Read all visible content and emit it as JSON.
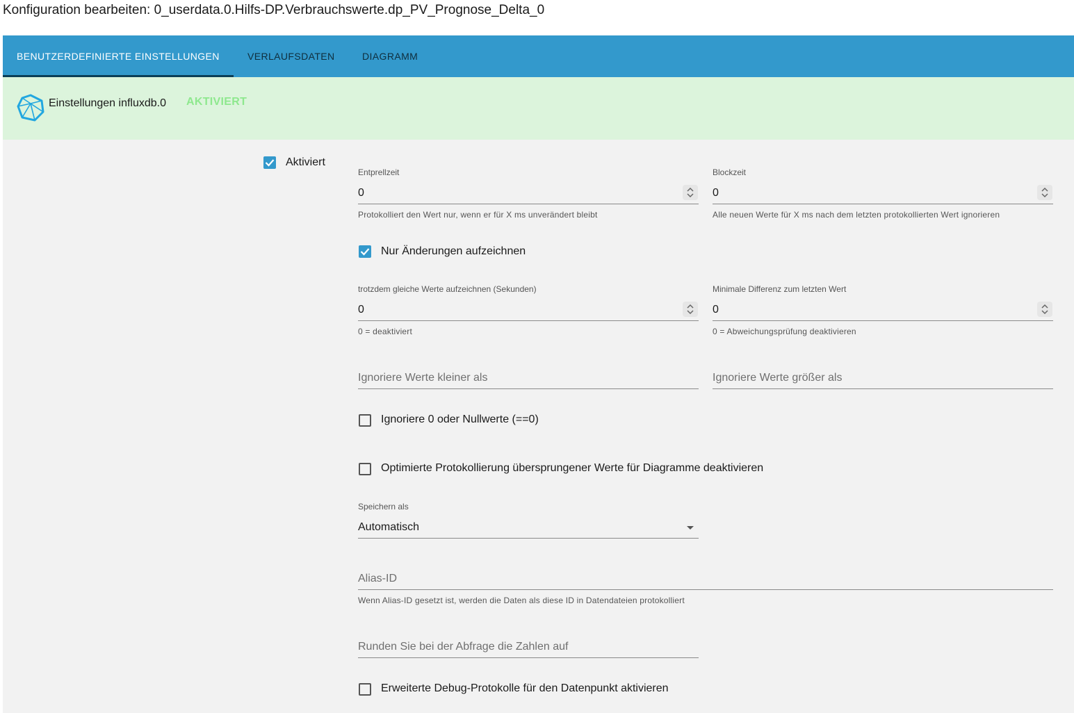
{
  "dialog": {
    "title": "Konfiguration bearbeiten: 0_userdata.0.Hilfs-DP.Verbrauchswerte.dp_PV_Prognose_Delta_0"
  },
  "tabs": [
    {
      "label": "BENUTZERDEFINIERTE EINSTELLUNGEN",
      "active": true
    },
    {
      "label": "VERLAUFSDATEN",
      "active": false
    },
    {
      "label": "DIAGRAMM",
      "active": false
    }
  ],
  "instance": {
    "icon": "influxdb-icon",
    "name": "Einstellungen influxdb.0",
    "status": "AKTIVIERT",
    "status_color": "#8ee88e"
  },
  "settings": {
    "enabled": {
      "label": "Aktiviert",
      "checked": true
    },
    "debounce": {
      "label": "Entprellzeit",
      "value": "0",
      "helper": "Protokolliert den Wert nur, wenn er für X ms unverändert bleibt"
    },
    "blocktime": {
      "label": "Blockzeit",
      "value": "0",
      "helper": "Alle neuen Werte für X ms nach dem letzten protokollierten Wert ignorieren"
    },
    "changes_only": {
      "label": "Nur Änderungen aufzeichnen",
      "checked": true
    },
    "changes_relog": {
      "label": "trotzdem gleiche Werte aufzeichnen (Sekunden)",
      "value": "0",
      "helper": "0 = deaktiviert"
    },
    "min_diff": {
      "label": "Minimale Differenz zum letzten Wert",
      "value": "0",
      "helper": "0 = Abweichungsprüfung deaktivieren"
    },
    "ignore_below": {
      "placeholder": "Ignoriere Werte kleiner als"
    },
    "ignore_above": {
      "placeholder": "Ignoriere Werte größer als"
    },
    "ignore_zero": {
      "label": "Ignoriere 0 oder Nullwerte (==0)",
      "checked": false
    },
    "disable_skipped": {
      "label": "Optimierte Protokollierung übersprungener Werte für Diagramme deaktivieren",
      "checked": false
    },
    "store_as": {
      "label": "Speichern als",
      "value": "Automatisch"
    },
    "alias_id": {
      "placeholder": "Alias-ID",
      "helper": "Wenn Alias-ID gesetzt ist, werden die Daten als diese ID in Datendateien protokolliert"
    },
    "round": {
      "placeholder": "Runden Sie bei der Abfrage die Zahlen auf"
    },
    "debug": {
      "label": "Erweiterte Debug-Protokolle für den Datenpunkt aktivieren",
      "checked": false
    }
  },
  "colors": {
    "tabbar": "#3399cc",
    "header_bg": "#dcf4dc",
    "content_bg": "#f2f2f2",
    "checkbox": "#3399cc"
  }
}
